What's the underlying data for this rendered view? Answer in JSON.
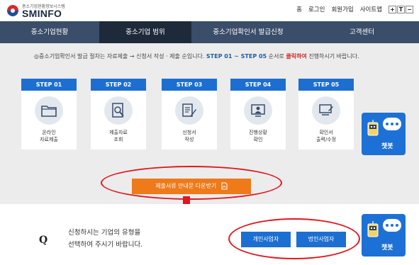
{
  "header": {
    "logo_sub": "중소기업현황정보시스템",
    "logo_name": "SMINFO",
    "util_links": [
      "홈",
      "로그인",
      "회원가입",
      "사이트맵"
    ],
    "font_controls": [
      "+",
      "T",
      "−"
    ]
  },
  "nav": {
    "items": [
      {
        "label": "중소기업현황",
        "active": false
      },
      {
        "label": "중소기업 범위",
        "active": true
      },
      {
        "label": "중소기업확인서 발급신청",
        "active": false
      },
      {
        "label": "고객센터",
        "active": false
      }
    ]
  },
  "notice": {
    "prefix": "◎중소기업확인서 발급 절차는 자료제출 → 신청서 작성 · 제출 순입니다.",
    "steps_range": "STEP 01 ~ STEP 05",
    "middle": "순서로",
    "highlight": "클릭하여",
    "suffix": "진행하시기 바랍니다."
  },
  "steps": [
    {
      "head": "STEP 01",
      "label1": "온라인",
      "label2": "자료제출",
      "icon": "folder-icon"
    },
    {
      "head": "STEP 02",
      "label1": "제출자료",
      "label2": "조회",
      "icon": "document-search-icon"
    },
    {
      "head": "STEP 03",
      "label1": "신청서",
      "label2": "작성",
      "icon": "form-edit-icon"
    },
    {
      "head": "STEP 04",
      "label1": "진행상황",
      "label2": "확인",
      "icon": "monitor-user-icon"
    },
    {
      "head": "STEP 05",
      "label1": "확인서",
      "label2": "출력/수정",
      "icon": "pc-print-icon"
    }
  ],
  "chatbot": {
    "label": "챗봇"
  },
  "download": {
    "label": "제출서류 안내문 다운받기",
    "icon": "pdf-icon"
  },
  "question": {
    "mark": "Q",
    "line1": "신청하시는 기업의 유형을",
    "line2": "선택하여 주시기 바랍니다."
  },
  "type_buttons": {
    "individual": "개인사업자",
    "corporate": "법인사업자"
  },
  "colors": {
    "nav": "#3a4d69",
    "nav_active": "#1e2a3a",
    "step_blue": "#1c6fd1",
    "download_orange": "#ef7a1a",
    "highlight_red": "#e0171e"
  }
}
